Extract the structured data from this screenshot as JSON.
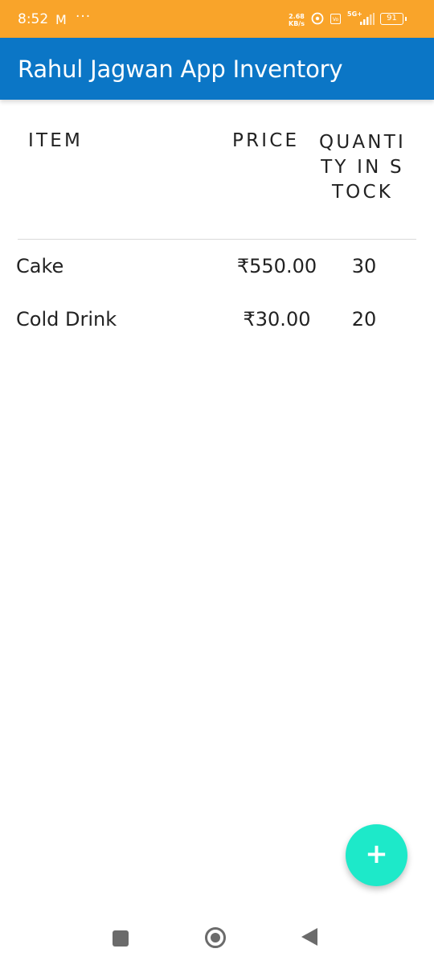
{
  "status_bar": {
    "time": "8:52",
    "mail_icon": "M",
    "more_dots": "···",
    "speed_value": "2.68",
    "speed_unit": "KB/s",
    "volte_label": "Vo",
    "network": "5G+",
    "battery": "91"
  },
  "app_bar": {
    "title": "Rahul Jagwan App Inventory",
    "color": "#0b76c6"
  },
  "table": {
    "headers": {
      "item": "ITEM",
      "price": "PRICE",
      "quantity": "QUANTITY IN STOCK"
    },
    "rows": [
      {
        "item": "Cake",
        "price": "₹550.00",
        "quantity": "30"
      },
      {
        "item": "Cold Drink",
        "price": "₹30.00",
        "quantity": "20"
      }
    ]
  },
  "fab": {
    "label": "+",
    "icon": "plus-icon",
    "color": "#1de9c9"
  },
  "nav": {
    "recents": "square-icon",
    "home": "circle-icon",
    "back": "triangle-back-icon"
  },
  "colors": {
    "status_bar": "#f9a42a",
    "app_bar": "#0b76c6",
    "fab": "#1de9c9"
  }
}
